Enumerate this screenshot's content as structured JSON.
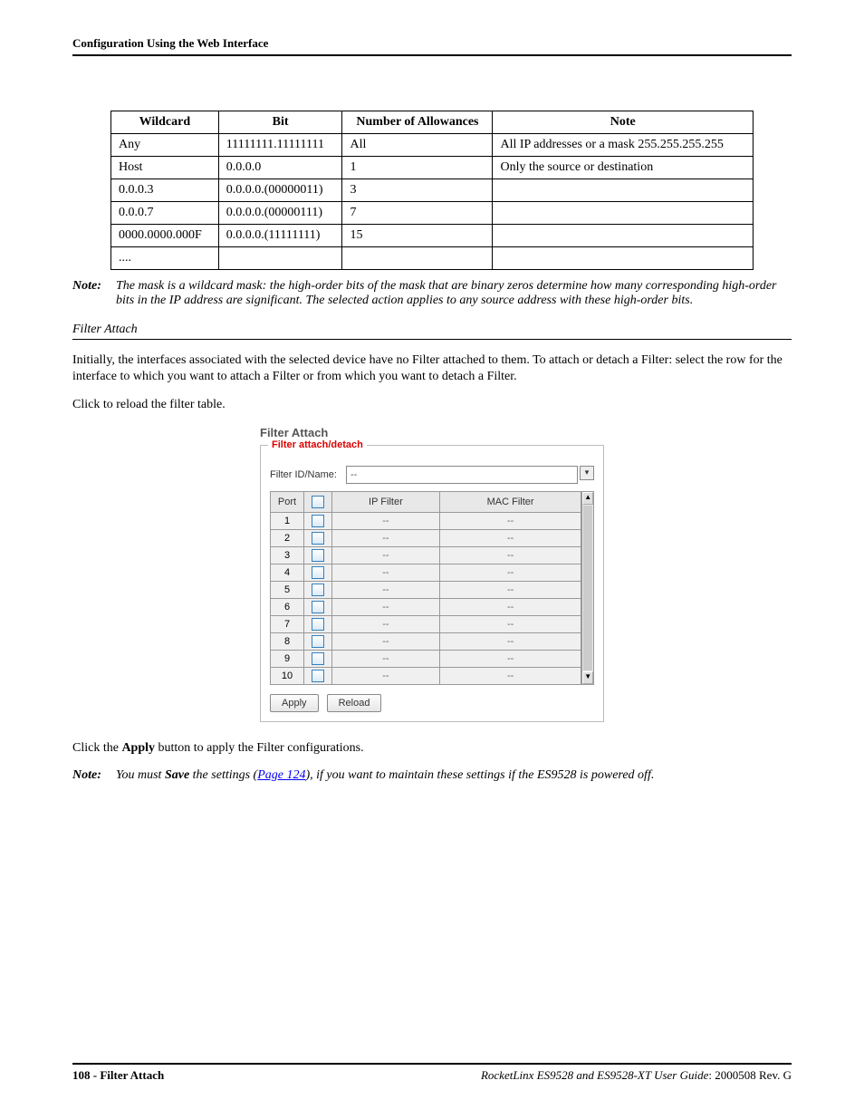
{
  "header": "Configuration Using the Web Interface",
  "wildcard_table": {
    "headers": [
      "Wildcard",
      "Bit",
      "Number of Allowances",
      "Note"
    ],
    "rows": [
      [
        "Any",
        "11111111.11111111",
        "All",
        "All IP addresses or a mask 255.255.255.255"
      ],
      [
        "Host",
        "0.0.0.0",
        "1",
        "Only the source or destination"
      ],
      [
        "0.0.0.3",
        "0.0.0.0.(00000011)",
        "3",
        ""
      ],
      [
        "0.0.0.7",
        "0.0.0.0.(00000111)",
        "7",
        ""
      ],
      [
        "0000.0000.000F",
        "0.0.0.0.(11111111)",
        "15",
        ""
      ],
      [
        "....",
        "",
        "",
        ""
      ]
    ]
  },
  "note1": {
    "label": "Note:",
    "text": "The mask is a wildcard mask: the high-order bits of the mask that are binary zeros determine how many corresponding high-order bits in the IP address are significant. The selected action applies to any source address with these high-order bits."
  },
  "section_title": "Filter Attach",
  "para1": "Initially, the interfaces associated with the selected device have no Filter attached to them. To attach or detach a Filter: select the row for the interface to which you want to attach a Filter or from which you want to detach a Filter.",
  "para2": "Click  to reload the filter table.",
  "ui": {
    "title": "Filter Attach",
    "legend": "Filter attach/detach",
    "idname_label": "Filter ID/Name:",
    "idname_value": "--",
    "columns": {
      "port": "Port",
      "ip": "IP Filter",
      "mac": "MAC Filter"
    },
    "rows": [
      {
        "port": "1",
        "ip": "--",
        "mac": "--"
      },
      {
        "port": "2",
        "ip": "--",
        "mac": "--"
      },
      {
        "port": "3",
        "ip": "--",
        "mac": "--"
      },
      {
        "port": "4",
        "ip": "--",
        "mac": "--"
      },
      {
        "port": "5",
        "ip": "--",
        "mac": "--"
      },
      {
        "port": "6",
        "ip": "--",
        "mac": "--"
      },
      {
        "port": "7",
        "ip": "--",
        "mac": "--"
      },
      {
        "port": "8",
        "ip": "--",
        "mac": "--"
      },
      {
        "port": "9",
        "ip": "--",
        "mac": "--"
      },
      {
        "port": "10",
        "ip": "--",
        "mac": "--"
      }
    ],
    "apply_btn": "Apply",
    "reload_btn": "Reload"
  },
  "apply_line": {
    "pre": "Click the ",
    "bold": "Apply",
    "post": " button to apply the Filter configurations."
  },
  "note2": {
    "label": "Note:",
    "pre": "You must ",
    "bold": "Save",
    "mid": " the settings (",
    "link": "Page 124",
    "post": "), if you want to maintain these settings if the ES9528 is powered off."
  },
  "footer": {
    "left": "108 - Filter Attach",
    "right_italic": "RocketLinx ES9528 and ES9528-XT User Guide",
    "right_rest": ": 2000508 Rev. G"
  }
}
